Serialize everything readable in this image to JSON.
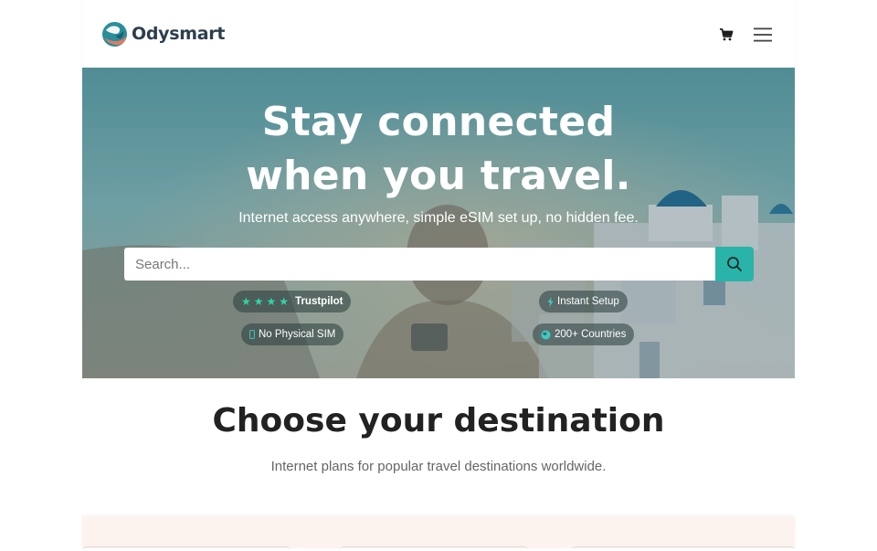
{
  "header": {
    "brand_name": "Odysmart",
    "logo_icon": "globe-logo-icon",
    "cart_icon": "cart-icon",
    "menu_icon": "hamburger-menu-icon"
  },
  "hero": {
    "title_line1": "Stay connected",
    "title_line2": "when you travel.",
    "subtitle": "Internet access anywhere, simple eSIM set up, no hidden fee.",
    "search": {
      "placeholder": "Search...",
      "value": ""
    },
    "search_icon": "search-icon",
    "badges": [
      {
        "label": "Trustpilot",
        "icon": "star-icon",
        "stars": 4
      },
      {
        "label": "Instant Setup",
        "icon": "lightning-icon"
      },
      {
        "label": "No Physical SIM",
        "icon": "phone-icon"
      },
      {
        "label": "200+ Countries",
        "icon": "globe-icon"
      }
    ]
  },
  "destinations": {
    "title": "Choose your destination",
    "subtitle": "Internet plans for popular travel destinations worldwide."
  },
  "colors": {
    "accent": "#2ab3a8",
    "brand_text": "#2d3e4e",
    "star": "#2fd4a6",
    "panel_bg": "#fdf3ee"
  }
}
